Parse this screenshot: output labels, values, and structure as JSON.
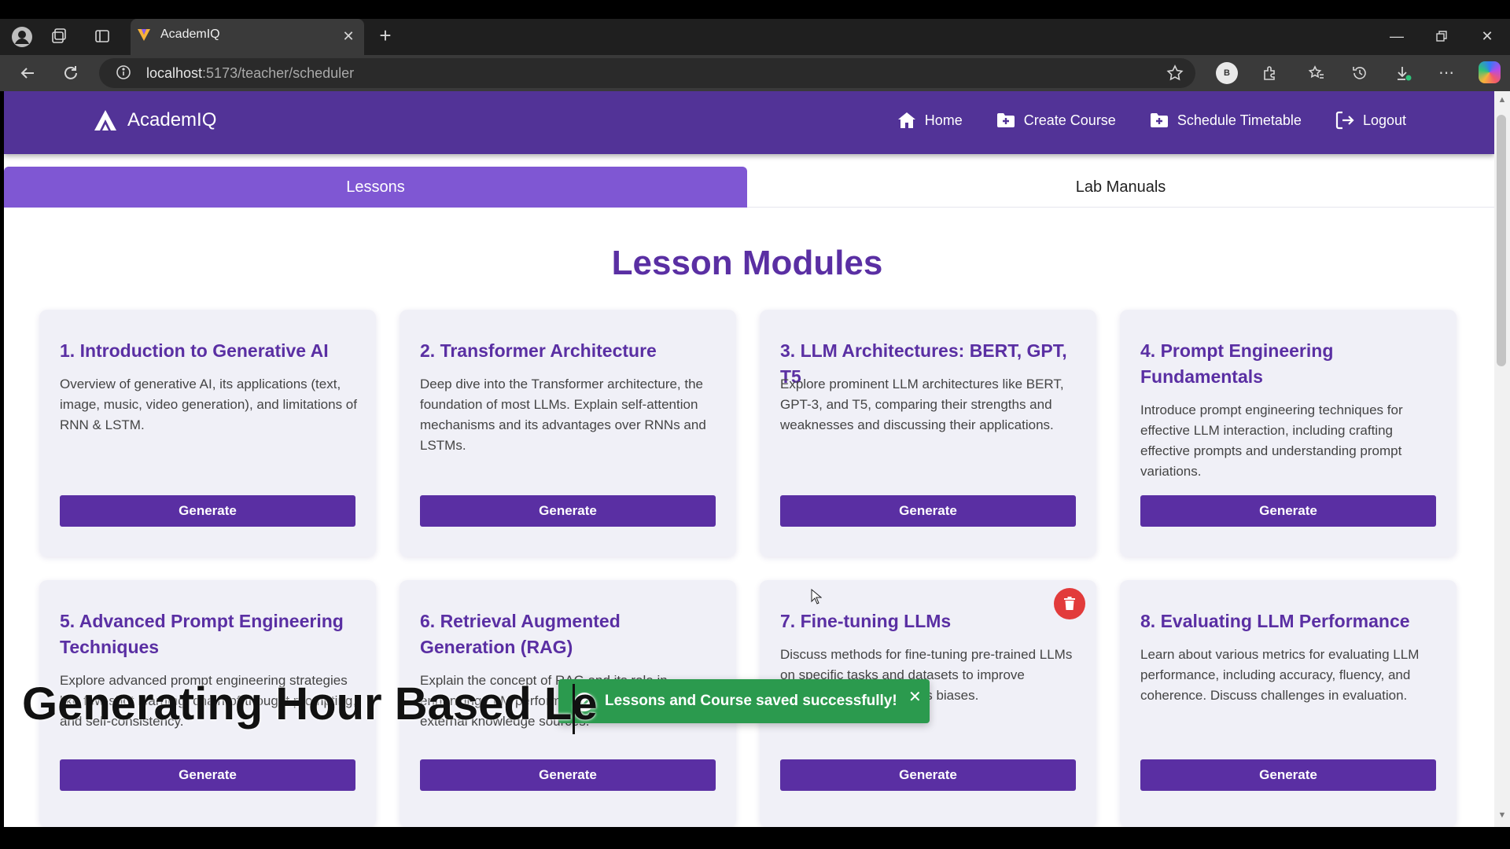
{
  "browser": {
    "tab_title": "AcademIQ",
    "url_host": "localhost",
    "url_path": ":5173/teacher/scheduler",
    "profile_initial": "B"
  },
  "app": {
    "brand": "AcademIQ",
    "nav": {
      "home": "Home",
      "create_course": "Create Course",
      "schedule_timetable": "Schedule Timetable",
      "logout": "Logout"
    },
    "tabs": {
      "lessons": "Lessons",
      "lab_manuals": "Lab Manuals"
    },
    "heading": "Lesson Modules",
    "generate_label": "Generate",
    "modules": [
      {
        "title": "1. Introduction to Generative AI",
        "description": "Overview of generative AI, its applications (text, image, music, video generation), and limitations of RNN & LSTM."
      },
      {
        "title": "2. Transformer Architecture",
        "description": "Deep dive into the Transformer architecture, the foundation of most LLMs. Explain self-attention mechanisms and its advantages over RNNs and LSTMs."
      },
      {
        "title": "3. LLM Architectures: BERT, GPT, T5",
        "description": "Explore prominent LLM architectures like BERT, GPT-3, and T5, comparing their strengths and weaknesses and discussing their applications."
      },
      {
        "title": "4. Prompt Engineering Fundamentals",
        "description": "Introduce prompt engineering techniques for effective LLM interaction, including crafting effective prompts and understanding prompt variations."
      },
      {
        "title": "5. Advanced Prompt Engineering Techniques",
        "description": "Explore advanced prompt engineering strategies like few-shot learning, chain-of-thought prompting, and self-consistency."
      },
      {
        "title": "6. Retrieval Augmented Generation (RAG)",
        "description": "Explain the concept of RAG and its role in enhancing LLM performance by integrating external knowledge sources."
      },
      {
        "title": "7. Fine-tuning LLMs",
        "description": "Discuss methods for fine-tuning pre-trained LLMs on specific tasks and datasets to improve performance and address biases."
      },
      {
        "title": "8. Evaluating LLM Performance",
        "description": "Learn about various metrics for evaluating LLM performance, including accuracy, fluency, and coherence. Discuss challenges in evaluation."
      }
    ],
    "toast": "Lessons and Course saved successfully!"
  },
  "overlay_caption": "Generating Hour Based Le",
  "colors": {
    "navbar": "#523397",
    "active_tab": "#7f57d3",
    "primary": "#5a2fa3",
    "card_bg": "#f0f0f7",
    "toast": "#2b9a4e",
    "delete": "#e23b3b"
  }
}
